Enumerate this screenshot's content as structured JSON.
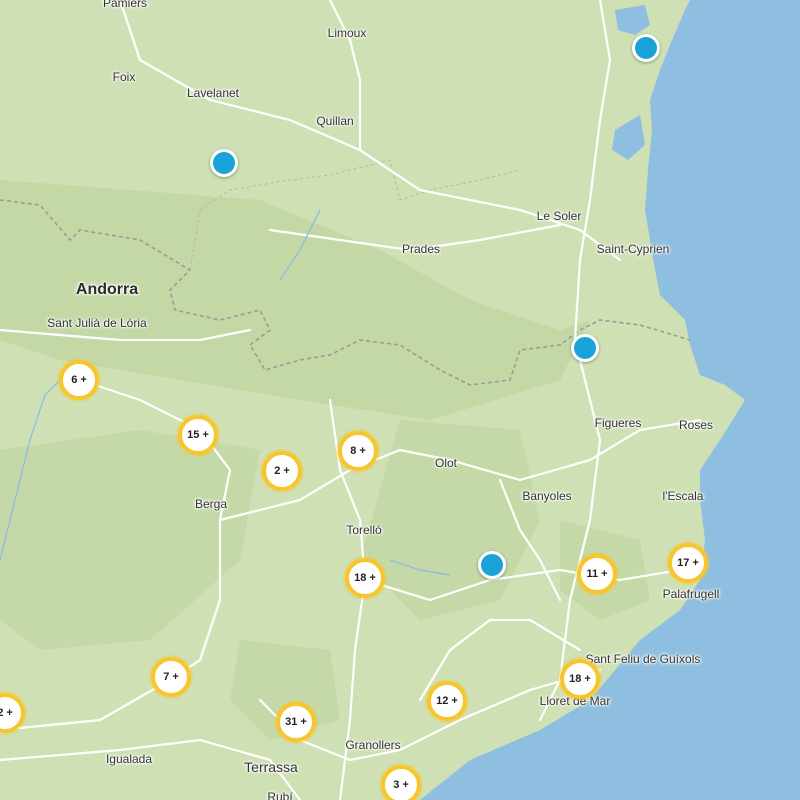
{
  "map": {
    "colors": {
      "land": "#cfe0b4",
      "sea": "#8fbfe0",
      "road": "#ffffff",
      "border": "#9a9a9a",
      "cluster_ring": "#f7c52d",
      "marker": "#1aa3d6"
    },
    "labels": {
      "pamiers": "Pamiers",
      "limoux": "Limoux",
      "foix": "Foix",
      "lavelanet": "Lavelanet",
      "quillan": "Quillan",
      "le_soler": "Le Soler",
      "prades": "Prades",
      "saint_cyprien": "Saint-Cyprien",
      "andorra": "Andorra",
      "sant_julia": "Sant Julià de Lòria",
      "figueres": "Figueres",
      "roses": "Roses",
      "olot": "Olot",
      "berga": "Berga",
      "banyoles": "Banyoles",
      "lescala": "l'Escala",
      "torrello": "Torelló",
      "palafrugell": "Palafrugell",
      "sant_feliu": "Sant Feliu de Guíxols",
      "lloret": "Lloret de Mar",
      "igualada": "Igualada",
      "granollers": "Granollers",
      "terrassa": "Terrassa",
      "rubi": "Rubí"
    },
    "clusters": [
      "6 +",
      "15 +",
      "2 +",
      "8 +",
      "18 +",
      "11 +",
      "17 +",
      "7 +",
      "18 +",
      "12 +",
      "31 +",
      "3 +",
      "2 +"
    ]
  }
}
